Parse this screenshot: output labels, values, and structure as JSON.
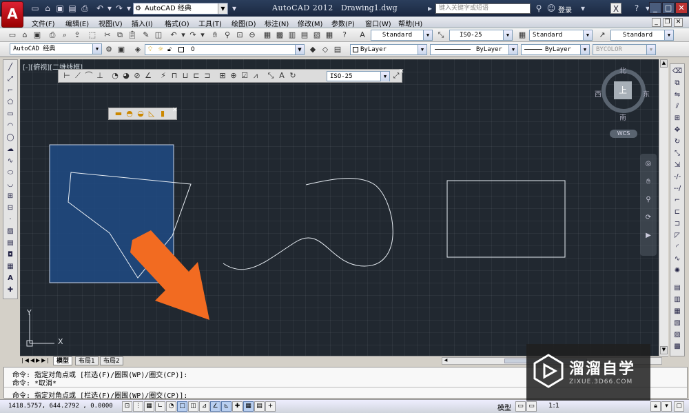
{
  "titlebar": {
    "logo": "A",
    "workspace": "AutoCAD 经典",
    "app_title": "AutoCAD 2012",
    "doc_title": "Drawing1.dwg",
    "search_placeholder": "键入关键字或短语",
    "login": "登录"
  },
  "menu": {
    "items": [
      "文件(F)",
      "编辑(E)",
      "视图(V)",
      "插入(I)",
      "格式(O)",
      "工具(T)",
      "绘图(D)",
      "标注(N)",
      "修改(M)",
      "参数(P)",
      "窗口(W)",
      "帮助(H)"
    ]
  },
  "styles": {
    "text_style": "Standard",
    "dim_style": "ISO-25",
    "table_style": "Standard",
    "multileader_style": "Standard"
  },
  "properties": {
    "workspace_combo": "AutoCAD 经典",
    "layer": "0",
    "color": "ByLayer",
    "linetype": "ByLayer",
    "lineweight": "ByLayer",
    "plotstyle": "BYCOLOR"
  },
  "canvas": {
    "viewport_label": "[-][俯视][二维线框]",
    "dim_toolbar_style": "ISO-25",
    "viewcube": {
      "north": "北",
      "south": "南",
      "east": "东",
      "west": "西",
      "top": "上",
      "wcs": "WCS"
    },
    "ucs_x": "X",
    "ucs_y": "Y"
  },
  "layout_tabs": [
    "模型",
    "布局1",
    "布局2"
  ],
  "command": {
    "line1": "命令: 指定对角点或 [栏选(F)/圈围(WP)/圈交(CP)]:",
    "line2": "命令: *取消*",
    "line3": "命令: 指定对角点或 [栏选(F)/圈围(WP)/圈交(CP)]:"
  },
  "status": {
    "coords": "1418.5757, 644.2792 , 0.0000",
    "model_label": "模型",
    "scale": "1:1"
  },
  "watermark": {
    "title": "溜溜自学",
    "url": "ZIXUE.3D66.COM"
  },
  "colors": {
    "canvas_bg": "#212830",
    "selection_fill": "#1f4a84",
    "arrow": "#f26b21"
  }
}
